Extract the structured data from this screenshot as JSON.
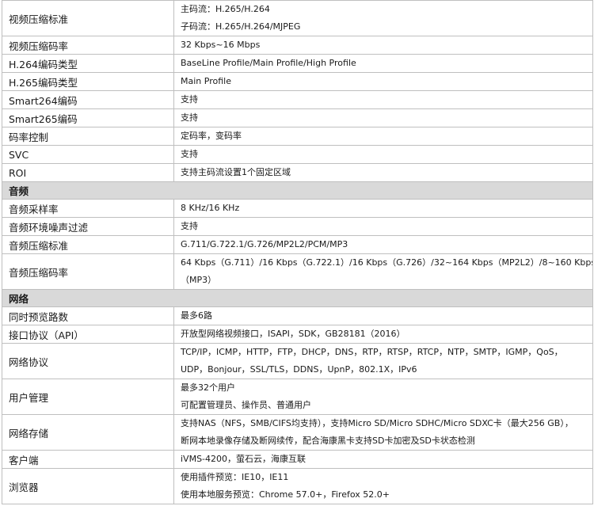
{
  "rows": [
    {
      "key": "视频压缩标准",
      "values": [
        "主码流：H.265/H.264",
        "子码流：H.265/H.264/MJPEG"
      ]
    },
    {
      "key": "视频压缩码率",
      "values": [
        "32 Kbps~16 Mbps"
      ]
    },
    {
      "key": "H.264编码类型",
      "values": [
        "BaseLine Profile/Main Profile/High Profile"
      ]
    },
    {
      "key": "H.265编码类型",
      "values": [
        "Main Profile"
      ]
    },
    {
      "key": "Smart264编码",
      "values": [
        "支持"
      ]
    },
    {
      "key": "Smart265编码",
      "values": [
        "支持"
      ]
    },
    {
      "key": "码率控制",
      "values": [
        "定码率，变码率"
      ]
    },
    {
      "key": "SVC",
      "values": [
        "支持"
      ]
    },
    {
      "key": "ROI",
      "values": [
        "支持主码流设置1个固定区域"
      ]
    },
    {
      "section": "音频"
    },
    {
      "key": "音频采样率",
      "values": [
        "8 KHz/16 KHz"
      ]
    },
    {
      "key": "音频环境噪声过滤",
      "values": [
        "支持"
      ]
    },
    {
      "key": "音频压缩标准",
      "values": [
        "G.711/G.722.1/G.726/MP2L2/PCM/MP3"
      ]
    },
    {
      "key": "音频压缩码率",
      "values": [
        "64 Kbps（G.711）/16 Kbps（G.722.1）/16 Kbps（G.726）/32~164 Kbps（MP2L2）/8~160 Kbps",
        "（MP3）"
      ]
    },
    {
      "section": "网络"
    },
    {
      "key": "同时预览路数",
      "values": [
        "最多6路"
      ]
    },
    {
      "key": "接口协议（API）",
      "values": [
        "开放型网络视频接口，ISAPI，SDK，GB28181（2016）"
      ]
    },
    {
      "key": "网络协议",
      "values": [
        "TCP/IP，ICMP，HTTP，FTP，DHCP，DNS，RTP，RTSP，RTCP，NTP，SMTP，IGMP，QoS，",
        "UDP，Bonjour，SSL/TLS，DDNS，UpnP，802.1X，IPv6"
      ]
    },
    {
      "key": "用户管理",
      "values": [
        "最多32个用户",
        "可配置管理员、操作员、普通用户"
      ]
    },
    {
      "key": "网络存储",
      "values": [
        "支持NAS（NFS，SMB/CIFS均支持），支持Micro SD/Micro SDHC/Micro SDXC卡（最大256 GB），",
        "断网本地录像存储及断网续传，配合海康黑卡支持SD卡加密及SD卡状态检测"
      ]
    },
    {
      "key": "客户端",
      "values": [
        "iVMS-4200，萤石云，海康互联"
      ]
    },
    {
      "key": "浏览器",
      "values": [
        "使用插件预览：IE10，IE11",
        "使用本地服务预览：Chrome 57.0+，Firefox 52.0+"
      ]
    }
  ]
}
